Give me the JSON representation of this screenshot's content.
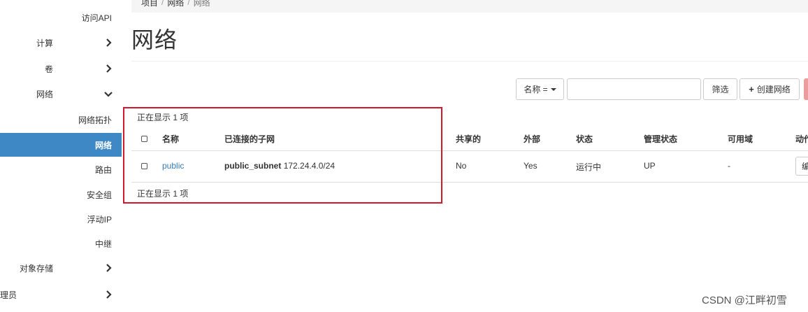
{
  "sidebar": {
    "items": [
      {
        "label": "访问API",
        "active": false,
        "chevron": "none"
      },
      {
        "label": "计算",
        "active": false,
        "chevron": "right"
      },
      {
        "label": "卷",
        "active": false,
        "chevron": "right"
      },
      {
        "label": "网络",
        "active": false,
        "chevron": "down"
      },
      {
        "label": "网络拓扑",
        "active": false,
        "chevron": "none"
      },
      {
        "label": "网络",
        "active": true,
        "chevron": "none"
      },
      {
        "label": "路由",
        "active": false,
        "chevron": "none"
      },
      {
        "label": "安全组",
        "active": false,
        "chevron": "none"
      },
      {
        "label": "浮动IP",
        "active": false,
        "chevron": "none"
      },
      {
        "label": "中继",
        "active": false,
        "chevron": "none"
      },
      {
        "label": "对象存储",
        "active": false,
        "chevron": "right"
      },
      {
        "label": "理员",
        "active": false,
        "chevron": "right"
      }
    ]
  },
  "breadcrumb": [
    "项目",
    "网络",
    "网络"
  ],
  "page": {
    "title": "网络"
  },
  "toolbar": {
    "filter_field_label": "名称 =",
    "filter_value": "",
    "filter_button": "筛选",
    "create_button": "创建网络"
  },
  "table": {
    "count_top": "正在显示 1 项",
    "count_bottom": "正在显示 1 项",
    "headers": [
      "名称",
      "已连接的子网",
      "共享的",
      "外部",
      "状态",
      "管理状态",
      "可用域",
      "动作"
    ],
    "rows": [
      {
        "name": "public",
        "subnet_name": "public_subnet",
        "subnet_cidr": "172.24.4.0/24",
        "shared": "No",
        "external": "Yes",
        "status": "运行中",
        "admin_state": "UP",
        "zone": "-",
        "action": "编"
      }
    ]
  },
  "watermark": "CSDN @江畔初雪",
  "colors": {
    "active_bg": "#3f88c6",
    "link": "#337ab7",
    "annotation": "#d3182a",
    "danger": "#eb9c9c"
  }
}
